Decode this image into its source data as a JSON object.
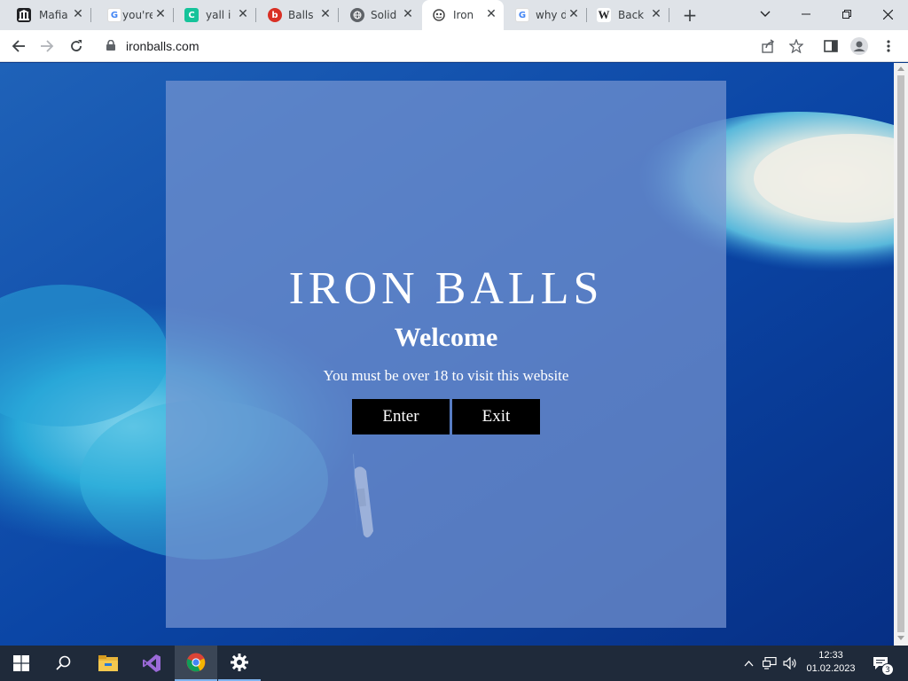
{
  "browser": {
    "tabs": [
      {
        "title": "Mafia",
        "favicon": "museum-icon"
      },
      {
        "title": "you're",
        "favicon": "google-icon"
      },
      {
        "title": "yall i",
        "favicon": "grammarly-icon"
      },
      {
        "title": "Balls",
        "favicon": "b-icon"
      },
      {
        "title": "Solid",
        "favicon": "globe-icon"
      },
      {
        "title": "Iron",
        "favicon": "ironballs-icon"
      },
      {
        "title": "why d",
        "favicon": "google-icon"
      },
      {
        "title": "Back",
        "favicon": "wikipedia-icon"
      }
    ],
    "active_tab_index": 5,
    "url": "ironballs.com"
  },
  "page": {
    "brand": "IRON BALLS",
    "welcome": "Welcome",
    "notice": "You must be over 18 to visit this website",
    "enter_label": "Enter",
    "exit_label": "Exit"
  },
  "taskbar": {
    "time": "12:33",
    "date": "01.02.2023",
    "notification_count": "3"
  },
  "colors": {
    "accent": "#7fb4f0",
    "ocean": "#0a3a8a",
    "modal": "#7896d2",
    "button": "#000000"
  }
}
